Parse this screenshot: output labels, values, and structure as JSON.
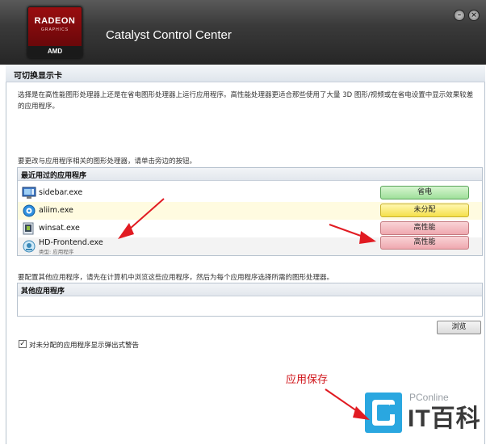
{
  "window": {
    "app_title": "Catalyst Control Center",
    "logo_text": "RADEON",
    "logo_sub": "GRAPHICS",
    "logo_brand": "AMD",
    "minimize_glyph": "–",
    "close_glyph": "×"
  },
  "panel": {
    "title": "可切换显示卡",
    "description": "选择是在高性能图形处理器上还是在省电图形处理器上运行应用程序。高性能处理器更适合那些使用了大量 3D 图形/视频或在省电设置中显示效果较差的应用程序。",
    "instruction": "要更改与应用程序相关的图形处理器，请单击旁边的按钮。"
  },
  "recent_apps": {
    "header": "最近用过的应用程序",
    "items": [
      {
        "name": "sidebar.exe",
        "sub": "",
        "mode": "省电",
        "color": "green",
        "icon": "sidebar-icon"
      },
      {
        "name": "aliim.exe",
        "sub": "",
        "mode": "未分配",
        "color": "yellow",
        "icon": "aliim-icon"
      },
      {
        "name": "winsat.exe",
        "sub": "",
        "mode": "高性能",
        "color": "red",
        "icon": "winsat-icon"
      },
      {
        "name": "HD-Frontend.exe",
        "sub": "类型: 应用程序",
        "mode": "高性能",
        "color": "red",
        "icon": "hd-frontend-icon"
      }
    ]
  },
  "other_apps": {
    "instruction": "要配置其他应用程序，请先在计算机中浏览这些应用程序，然后为每个应用程序选择所需的图形处理器。",
    "header": "其他应用程序",
    "browse_label": "浏览"
  },
  "checkbox": {
    "checked": true,
    "mark": "✓",
    "label": "对未分配的应用程序显示弹出式警告"
  },
  "annotation": {
    "text": "应用保存"
  },
  "watermark": {
    "small": "PConline",
    "big": "IT百科"
  },
  "colors": {
    "arrow": "#e11b22",
    "accent_blue": "#2aa7e0"
  }
}
